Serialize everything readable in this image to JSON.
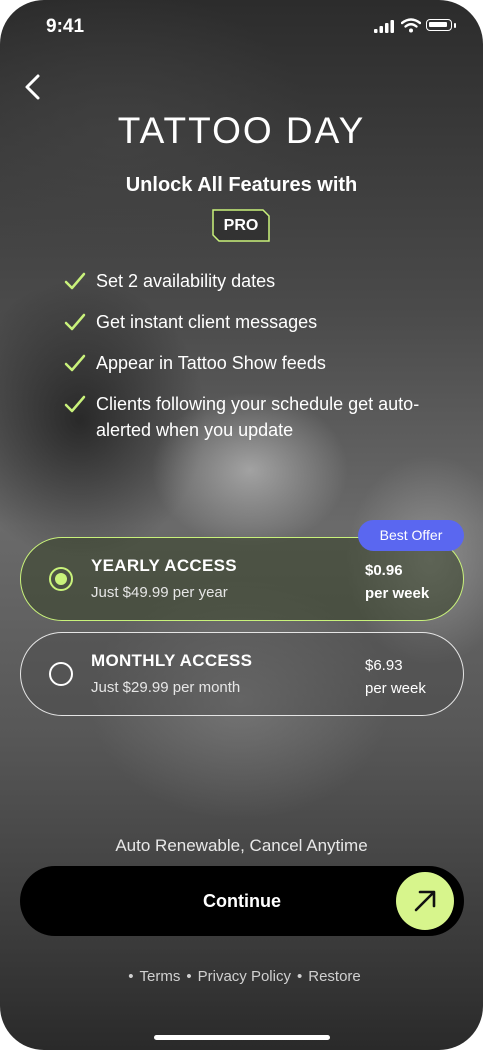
{
  "status_bar": {
    "time": "9:41"
  },
  "header": {
    "title": "TATTOO DAY",
    "subtitle": "Unlock All Features with",
    "badge": "PRO"
  },
  "features": [
    "Set 2 availability dates",
    "Get instant client messages",
    "Appear in Tattoo Show feeds",
    "Clients following your schedule get auto-alerted when you update"
  ],
  "plans": [
    {
      "name": "YEARLY ACCESS",
      "price": "Just $49.99 per year",
      "weekly_price": "$0.96",
      "weekly_unit": "per week",
      "selected": true,
      "tag": "Best Offer"
    },
    {
      "name": "MONTHLY ACCESS",
      "price": "Just $29.99 per month",
      "weekly_price": "$6.93",
      "weekly_unit": "per week",
      "selected": false
    }
  ],
  "renewal_note": "Auto Renewable, Cancel Anytime",
  "cta": {
    "label": "Continue",
    "icon": "arrow-up-right-icon"
  },
  "footer_links": [
    "Terms",
    "Privacy Policy",
    "Restore"
  ],
  "colors": {
    "accent": "#c9f27b",
    "badge": "#5a67f0",
    "cta_bg": "#000000",
    "cta_icon_bg": "#d7f58c"
  }
}
